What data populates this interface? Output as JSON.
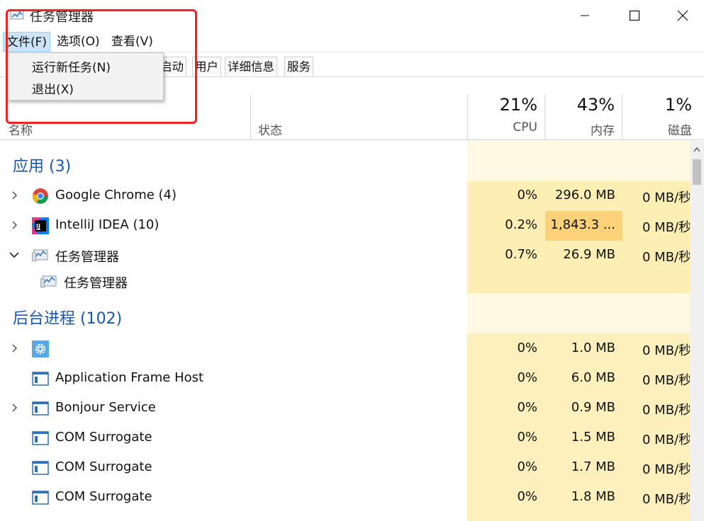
{
  "window": {
    "title": "任务管理器"
  },
  "menu": {
    "file": "文件(F)",
    "options": "选项(O)",
    "view": "查看(V)"
  },
  "file_menu": {
    "run_new_task": "运行新任务(N)",
    "exit": "退出(X)"
  },
  "tabs": [
    "启动",
    "用户",
    "详细信息",
    "服务"
  ],
  "columns": {
    "name": "名称",
    "status": "状态",
    "cpu": {
      "label": "CPU",
      "percent": "21%"
    },
    "memory": {
      "label": "内存",
      "percent": "43%"
    },
    "disk": {
      "label": "磁盘",
      "percent": "1%"
    }
  },
  "apps": {
    "title": "应用 (3)",
    "rows": [
      {
        "name": "Google Chrome (4)",
        "icon": "chrome-icon",
        "cpu": "0%",
        "memory": "296.0 MB",
        "disk": "0 MB/秒"
      },
      {
        "name": "IntelliJ IDEA (10)",
        "icon": "intellij-icon",
        "cpu": "0.2%",
        "memory": "1,843.3 ...",
        "disk": "0 MB/秒"
      },
      {
        "name": "任务管理器",
        "icon": "task-manager-icon",
        "cpu": "0.7%",
        "memory": "26.9 MB",
        "disk": "0 MB/秒"
      }
    ],
    "child": {
      "name": "任务管理器",
      "icon": "task-manager-icon"
    }
  },
  "background": {
    "title": "后台进程 (102)",
    "rows": [
      {
        "name": "",
        "icon": "gear-icon",
        "cpu": "0%",
        "memory": "1.0 MB",
        "disk": "0 MB/秒"
      },
      {
        "name": "Application Frame Host",
        "icon": "window-icon",
        "cpu": "0%",
        "memory": "6.0 MB",
        "disk": "0 MB/秒"
      },
      {
        "name": "Bonjour Service",
        "icon": "window-icon",
        "cpu": "0%",
        "memory": "0.9 MB",
        "disk": "0 MB/秒"
      },
      {
        "name": "COM Surrogate",
        "icon": "window-icon",
        "cpu": "0%",
        "memory": "1.5 MB",
        "disk": "0 MB/秒"
      },
      {
        "name": "COM Surrogate",
        "icon": "window-icon",
        "cpu": "0%",
        "memory": "1.7 MB",
        "disk": "0 MB/秒"
      },
      {
        "name": "COM Surrogate",
        "icon": "window-icon",
        "cpu": "0%",
        "memory": "1.8 MB",
        "disk": "0 MB/秒"
      }
    ]
  },
  "colors": {
    "heat_light": "#fff4c4",
    "heat_mid": "#fce9a8",
    "heat_high": "#fbd27a",
    "group_title": "#1a56a8",
    "highlight_box": "#ee2222"
  }
}
